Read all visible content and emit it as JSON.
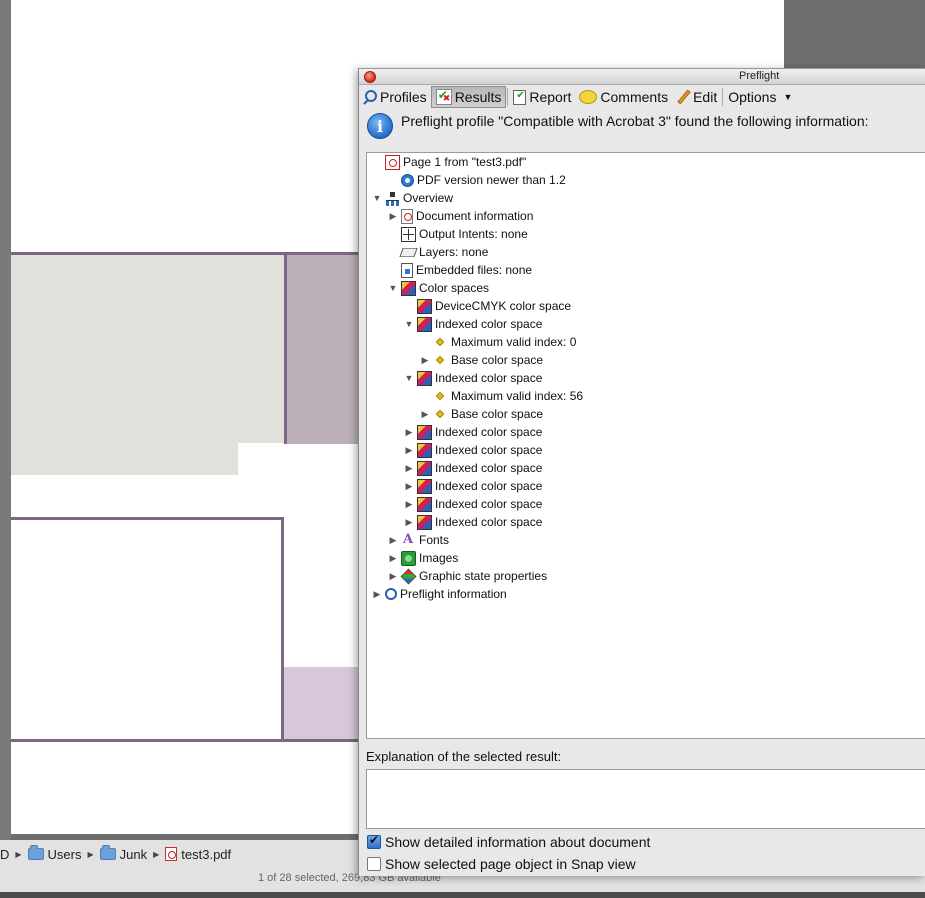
{
  "window": {
    "title": "Preflight"
  },
  "toolbar": {
    "profiles": "Profiles",
    "results": "Results",
    "report": "Report",
    "comments": "Comments",
    "edit": "Edit",
    "options": "Options"
  },
  "info": {
    "message": "Preflight profile \"Compatible with Acrobat 3\" found the following information:"
  },
  "tree": [
    {
      "label": "Page 1 from \"test3.pdf\"",
      "icon": "pdf-page-icon",
      "expander": "none"
    },
    {
      "label": "PDF version newer than 1.2",
      "icon": "version-info-icon",
      "expander": "none"
    },
    {
      "label": "Overview",
      "icon": "overview-tree-icon",
      "expander": "expanded"
    },
    {
      "label": "Document information",
      "icon": "document-info-icon",
      "expander": "collapsed"
    },
    {
      "label": "Output Intents: none",
      "icon": "output-intent-icon",
      "expander": "none"
    },
    {
      "label": "Layers: none",
      "icon": "layers-icon",
      "expander": "none"
    },
    {
      "label": "Embedded files: none",
      "icon": "embedded-file-icon",
      "expander": "none"
    },
    {
      "label": "Color spaces",
      "icon": "color-space-icon",
      "expander": "expanded"
    },
    {
      "label": "DeviceCMYK color space",
      "icon": "color-space-icon",
      "expander": "none"
    },
    {
      "label": "Indexed color space",
      "icon": "color-space-icon",
      "expander": "expanded"
    },
    {
      "label": "Maximum valid index: 0",
      "icon": "property-diamond-icon",
      "expander": "none"
    },
    {
      "label": "Base color space",
      "icon": "property-diamond-icon",
      "expander": "collapsed"
    },
    {
      "label": "Indexed color space",
      "icon": "color-space-icon",
      "expander": "expanded"
    },
    {
      "label": "Maximum valid index: 56",
      "icon": "property-diamond-icon",
      "expander": "none"
    },
    {
      "label": "Base color space",
      "icon": "property-diamond-icon",
      "expander": "collapsed"
    },
    {
      "label": "Indexed color space",
      "icon": "color-space-icon",
      "expander": "collapsed"
    },
    {
      "label": "Indexed color space",
      "icon": "color-space-icon",
      "expander": "collapsed"
    },
    {
      "label": "Indexed color space",
      "icon": "color-space-icon",
      "expander": "collapsed"
    },
    {
      "label": "Indexed color space",
      "icon": "color-space-icon",
      "expander": "collapsed"
    },
    {
      "label": "Indexed color space",
      "icon": "color-space-icon",
      "expander": "collapsed"
    },
    {
      "label": "Indexed color space",
      "icon": "color-space-icon",
      "expander": "collapsed"
    },
    {
      "label": "Fonts",
      "icon": "fonts-icon",
      "expander": "collapsed"
    },
    {
      "label": "Images",
      "icon": "images-icon",
      "expander": "collapsed"
    },
    {
      "label": "Graphic state properties",
      "icon": "graphic-state-icon",
      "expander": "collapsed"
    },
    {
      "label": "Preflight information",
      "icon": "preflight-info-icon",
      "expander": "collapsed"
    }
  ],
  "explanation": {
    "label": "Explanation of the selected result:",
    "text": ""
  },
  "options": {
    "show_detailed": {
      "label": "Show detailed information about document",
      "checked": true
    },
    "snap_view": {
      "label": "Show selected page object in Snap view",
      "checked": false
    }
  },
  "finder": {
    "path": [
      "D",
      "Users",
      "Junk",
      "test3.pdf"
    ],
    "status": "1 of 28 selected, 269,83 GB available"
  }
}
